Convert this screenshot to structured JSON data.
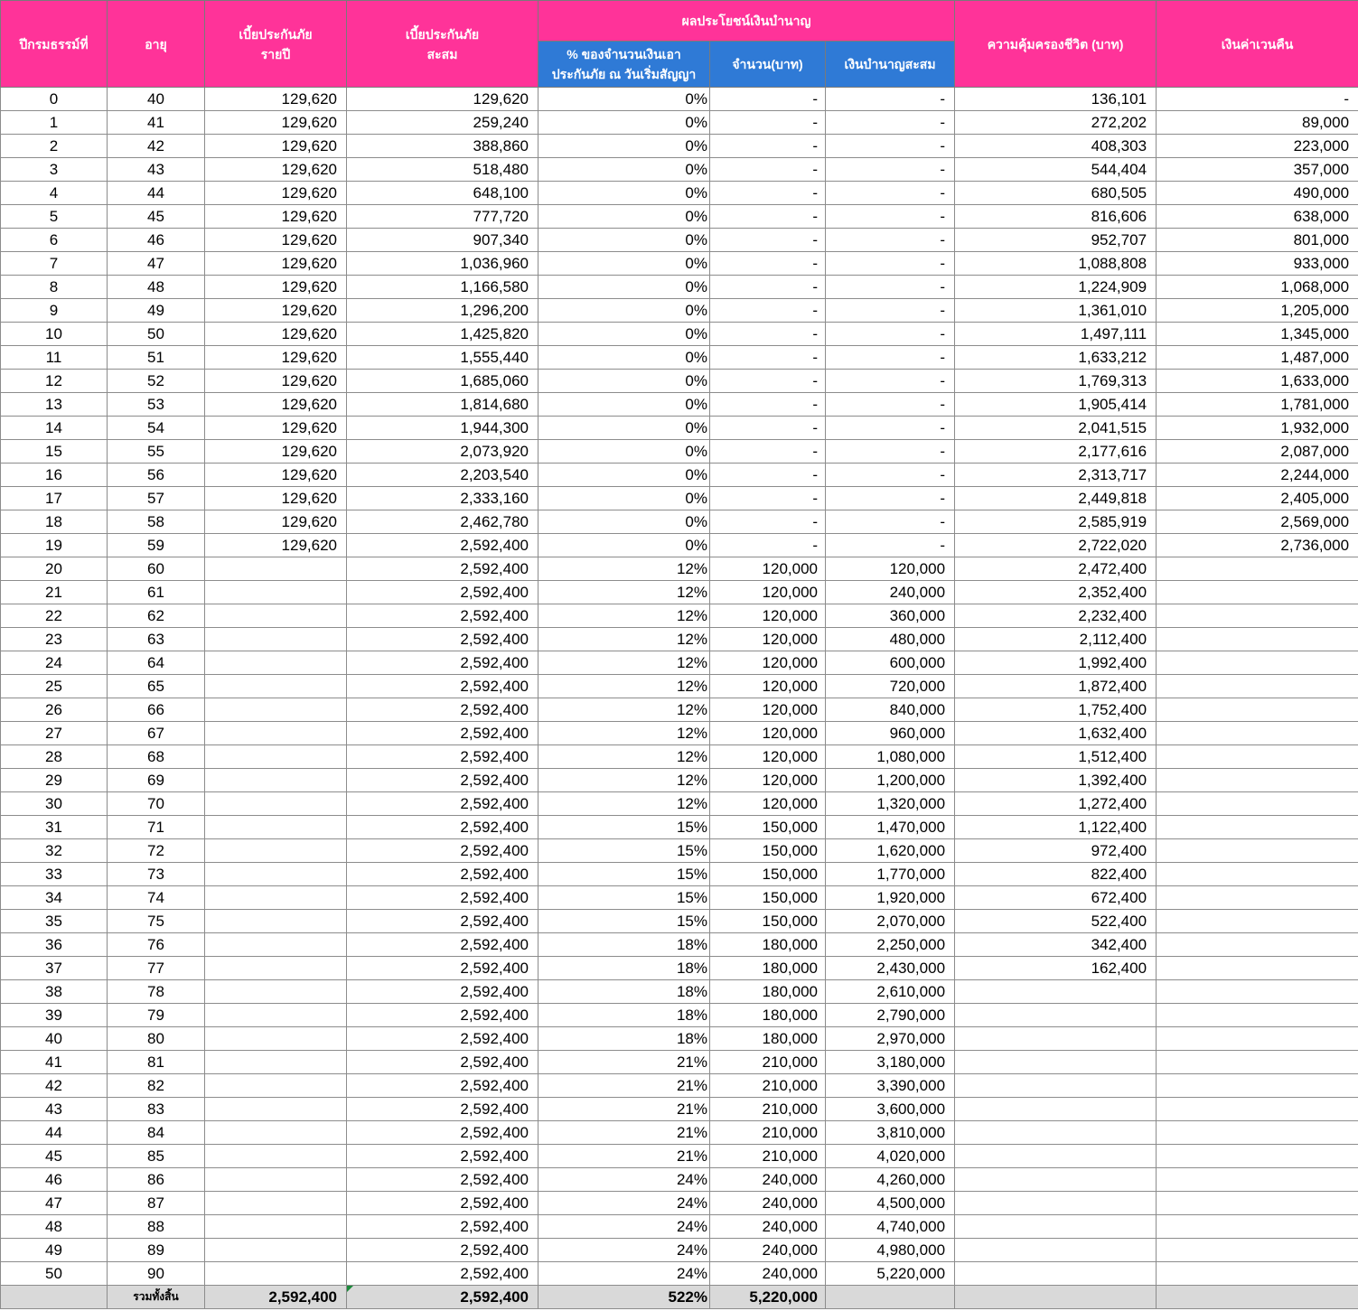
{
  "headers": {
    "year": "ปีกรมธรรม์ที่",
    "age": "อายุ",
    "annual_premium_1": "เบี้ยประกันภัย",
    "annual_premium_2": "รายปี",
    "cum_premium_1": "เบี้ยประกันภัย",
    "cum_premium_2": "สะสม",
    "pension_group": "ผลประโยชน์เงินบำนาญ",
    "pension_pct_1": "% ของจำนวนเงินเอา",
    "pension_pct_2": "ประกันภัย ณ วันเริ่มสัญญา",
    "pension_amount": "จำนวน(บาท)",
    "pension_cum": "เงินบำนาญสะสม",
    "life_coverage": "ความคุ้มครองชีวิต (บาท)",
    "surrender": "เงินค่าเวนคืน"
  },
  "colors": {
    "header_pink": "#ff3399",
    "header_blue": "#2f7ad6",
    "total_row_bg": "#d9d9d9"
  },
  "rows": [
    [
      "0",
      "40",
      "129,620",
      "129,620",
      "0%",
      "-",
      "-",
      "136,101",
      "-"
    ],
    [
      "1",
      "41",
      "129,620",
      "259,240",
      "0%",
      "-",
      "-",
      "272,202",
      "89,000"
    ],
    [
      "2",
      "42",
      "129,620",
      "388,860",
      "0%",
      "-",
      "-",
      "408,303",
      "223,000"
    ],
    [
      "3",
      "43",
      "129,620",
      "518,480",
      "0%",
      "-",
      "-",
      "544,404",
      "357,000"
    ],
    [
      "4",
      "44",
      "129,620",
      "648,100",
      "0%",
      "-",
      "-",
      "680,505",
      "490,000"
    ],
    [
      "5",
      "45",
      "129,620",
      "777,720",
      "0%",
      "-",
      "-",
      "816,606",
      "638,000"
    ],
    [
      "6",
      "46",
      "129,620",
      "907,340",
      "0%",
      "-",
      "-",
      "952,707",
      "801,000"
    ],
    [
      "7",
      "47",
      "129,620",
      "1,036,960",
      "0%",
      "-",
      "-",
      "1,088,808",
      "933,000"
    ],
    [
      "8",
      "48",
      "129,620",
      "1,166,580",
      "0%",
      "-",
      "-",
      "1,224,909",
      "1,068,000"
    ],
    [
      "9",
      "49",
      "129,620",
      "1,296,200",
      "0%",
      "-",
      "-",
      "1,361,010",
      "1,205,000"
    ],
    [
      "10",
      "50",
      "129,620",
      "1,425,820",
      "0%",
      "-",
      "-",
      "1,497,111",
      "1,345,000"
    ],
    [
      "11",
      "51",
      "129,620",
      "1,555,440",
      "0%",
      "-",
      "-",
      "1,633,212",
      "1,487,000"
    ],
    [
      "12",
      "52",
      "129,620",
      "1,685,060",
      "0%",
      "-",
      "-",
      "1,769,313",
      "1,633,000"
    ],
    [
      "13",
      "53",
      "129,620",
      "1,814,680",
      "0%",
      "-",
      "-",
      "1,905,414",
      "1,781,000"
    ],
    [
      "14",
      "54",
      "129,620",
      "1,944,300",
      "0%",
      "-",
      "-",
      "2,041,515",
      "1,932,000"
    ],
    [
      "15",
      "55",
      "129,620",
      "2,073,920",
      "0%",
      "-",
      "-",
      "2,177,616",
      "2,087,000"
    ],
    [
      "16",
      "56",
      "129,620",
      "2,203,540",
      "0%",
      "-",
      "-",
      "2,313,717",
      "2,244,000"
    ],
    [
      "17",
      "57",
      "129,620",
      "2,333,160",
      "0%",
      "-",
      "-",
      "2,449,818",
      "2,405,000"
    ],
    [
      "18",
      "58",
      "129,620",
      "2,462,780",
      "0%",
      "-",
      "-",
      "2,585,919",
      "2,569,000"
    ],
    [
      "19",
      "59",
      "129,620",
      "2,592,400",
      "0%",
      "-",
      "-",
      "2,722,020",
      "2,736,000"
    ],
    [
      "20",
      "60",
      "",
      "2,592,400",
      "12%",
      "120,000",
      "120,000",
      "2,472,400",
      ""
    ],
    [
      "21",
      "61",
      "",
      "2,592,400",
      "12%",
      "120,000",
      "240,000",
      "2,352,400",
      ""
    ],
    [
      "22",
      "62",
      "",
      "2,592,400",
      "12%",
      "120,000",
      "360,000",
      "2,232,400",
      ""
    ],
    [
      "23",
      "63",
      "",
      "2,592,400",
      "12%",
      "120,000",
      "480,000",
      "2,112,400",
      ""
    ],
    [
      "24",
      "64",
      "",
      "2,592,400",
      "12%",
      "120,000",
      "600,000",
      "1,992,400",
      ""
    ],
    [
      "25",
      "65",
      "",
      "2,592,400",
      "12%",
      "120,000",
      "720,000",
      "1,872,400",
      ""
    ],
    [
      "26",
      "66",
      "",
      "2,592,400",
      "12%",
      "120,000",
      "840,000",
      "1,752,400",
      ""
    ],
    [
      "27",
      "67",
      "",
      "2,592,400",
      "12%",
      "120,000",
      "960,000",
      "1,632,400",
      ""
    ],
    [
      "28",
      "68",
      "",
      "2,592,400",
      "12%",
      "120,000",
      "1,080,000",
      "1,512,400",
      ""
    ],
    [
      "29",
      "69",
      "",
      "2,592,400",
      "12%",
      "120,000",
      "1,200,000",
      "1,392,400",
      ""
    ],
    [
      "30",
      "70",
      "",
      "2,592,400",
      "12%",
      "120,000",
      "1,320,000",
      "1,272,400",
      ""
    ],
    [
      "31",
      "71",
      "",
      "2,592,400",
      "15%",
      "150,000",
      "1,470,000",
      "1,122,400",
      ""
    ],
    [
      "32",
      "72",
      "",
      "2,592,400",
      "15%",
      "150,000",
      "1,620,000",
      "972,400",
      ""
    ],
    [
      "33",
      "73",
      "",
      "2,592,400",
      "15%",
      "150,000",
      "1,770,000",
      "822,400",
      ""
    ],
    [
      "34",
      "74",
      "",
      "2,592,400",
      "15%",
      "150,000",
      "1,920,000",
      "672,400",
      ""
    ],
    [
      "35",
      "75",
      "",
      "2,592,400",
      "15%",
      "150,000",
      "2,070,000",
      "522,400",
      ""
    ],
    [
      "36",
      "76",
      "",
      "2,592,400",
      "18%",
      "180,000",
      "2,250,000",
      "342,400",
      ""
    ],
    [
      "37",
      "77",
      "",
      "2,592,400",
      "18%",
      "180,000",
      "2,430,000",
      "162,400",
      ""
    ],
    [
      "38",
      "78",
      "",
      "2,592,400",
      "18%",
      "180,000",
      "2,610,000",
      "",
      ""
    ],
    [
      "39",
      "79",
      "",
      "2,592,400",
      "18%",
      "180,000",
      "2,790,000",
      "",
      ""
    ],
    [
      "40",
      "80",
      "",
      "2,592,400",
      "18%",
      "180,000",
      "2,970,000",
      "",
      ""
    ],
    [
      "41",
      "81",
      "",
      "2,592,400",
      "21%",
      "210,000",
      "3,180,000",
      "",
      ""
    ],
    [
      "42",
      "82",
      "",
      "2,592,400",
      "21%",
      "210,000",
      "3,390,000",
      "",
      ""
    ],
    [
      "43",
      "83",
      "",
      "2,592,400",
      "21%",
      "210,000",
      "3,600,000",
      "",
      ""
    ],
    [
      "44",
      "84",
      "",
      "2,592,400",
      "21%",
      "210,000",
      "3,810,000",
      "",
      ""
    ],
    [
      "45",
      "85",
      "",
      "2,592,400",
      "21%",
      "210,000",
      "4,020,000",
      "",
      ""
    ],
    [
      "46",
      "86",
      "",
      "2,592,400",
      "24%",
      "240,000",
      "4,260,000",
      "",
      ""
    ],
    [
      "47",
      "87",
      "",
      "2,592,400",
      "24%",
      "240,000",
      "4,500,000",
      "",
      ""
    ],
    [
      "48",
      "88",
      "",
      "2,592,400",
      "24%",
      "240,000",
      "4,740,000",
      "",
      ""
    ],
    [
      "49",
      "89",
      "",
      "2,592,400",
      "24%",
      "240,000",
      "4,980,000",
      "",
      ""
    ],
    [
      "50",
      "90",
      "",
      "2,592,400",
      "24%",
      "240,000",
      "5,220,000",
      "",
      ""
    ]
  ],
  "totals": {
    "label": "รวมทั้งสิ้น",
    "annual_premium": "2,592,400",
    "cum_premium": "2,592,400",
    "pension_pct": "522%",
    "pension_amount": "5,220,000"
  }
}
